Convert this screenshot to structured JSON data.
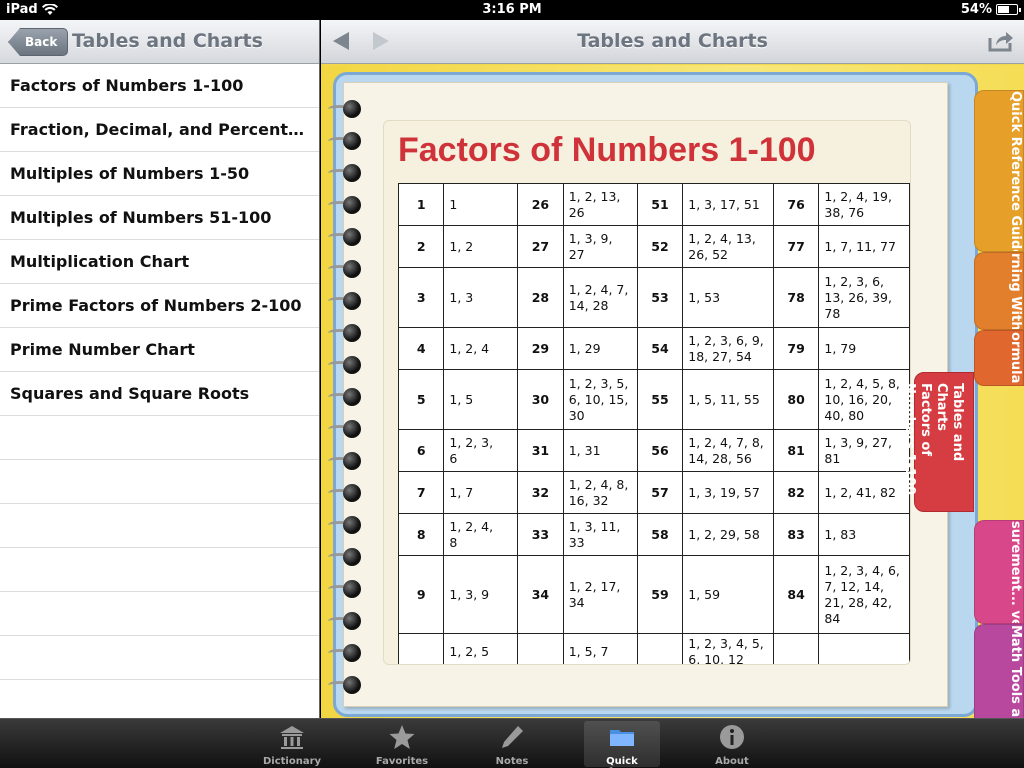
{
  "status": {
    "device": "iPad",
    "time": "3:16 PM",
    "battery": "54%"
  },
  "left": {
    "back_label": "Back",
    "title": "Tables and Charts",
    "items": [
      "Factors of Numbers 1-100",
      "Fraction, Decimal, and Percent Equ...",
      "Multiples of Numbers 1-50",
      "Multiples of Numbers 51-100",
      "Multiplication Chart",
      "Prime Factors of Numbers 2-100",
      "Prime Number Chart",
      "Squares and Square Roots"
    ]
  },
  "right": {
    "title": "Tables and Charts",
    "page_title": "Factors of Numbers 1-100",
    "table_rows": [
      [
        [
          "1",
          "1"
        ],
        [
          "26",
          "1, 2, 13,\n26"
        ],
        [
          "51",
          "1, 3, 17, 51"
        ],
        [
          "76",
          "1, 2, 4, 19,\n38, 76"
        ]
      ],
      [
        [
          "2",
          "1, 2"
        ],
        [
          "27",
          "1, 3, 9,\n27"
        ],
        [
          "52",
          "1, 2, 4, 13,\n26, 52"
        ],
        [
          "77",
          "1, 7, 11, 77"
        ]
      ],
      [
        [
          "3",
          "1, 3"
        ],
        [
          "28",
          "1, 2, 4, 7,\n14, 28"
        ],
        [
          "53",
          "1, 53"
        ],
        [
          "78",
          "1, 2, 3, 6,\n13, 26, 39,\n78"
        ]
      ],
      [
        [
          "4",
          "1, 2, 4"
        ],
        [
          "29",
          "1, 29"
        ],
        [
          "54",
          "1, 2, 3, 6, 9,\n18, 27, 54"
        ],
        [
          "79",
          "1, 79"
        ]
      ],
      [
        [
          "5",
          "1, 5"
        ],
        [
          "30",
          "1, 2, 3, 5,\n6, 10, 15,\n30"
        ],
        [
          "55",
          "1, 5, 11, 55"
        ],
        [
          "80",
          "1, 2, 4, 5, 8,\n10, 16, 20,\n40, 80"
        ]
      ],
      [
        [
          "6",
          "1, 2, 3,\n6"
        ],
        [
          "31",
          "1, 31"
        ],
        [
          "56",
          "1, 2, 4, 7, 8,\n14, 28, 56"
        ],
        [
          "81",
          "1, 3, 9, 27,\n81"
        ]
      ],
      [
        [
          "7",
          "1, 7"
        ],
        [
          "32",
          "1, 2, 4, 8,\n16, 32"
        ],
        [
          "57",
          "1, 3, 19, 57"
        ],
        [
          "82",
          "1, 2, 41, 82"
        ]
      ],
      [
        [
          "8",
          "1, 2, 4,\n8"
        ],
        [
          "33",
          "1, 3, 11,\n33"
        ],
        [
          "58",
          "1, 2, 29, 58"
        ],
        [
          "83",
          "1, 83"
        ]
      ],
      [
        [
          "9",
          "1, 3, 9"
        ],
        [
          "34",
          "1, 2, 17,\n34"
        ],
        [
          "59",
          "1, 59"
        ],
        [
          "84",
          "1, 2, 3, 4, 6,\n7, 12, 14,\n21, 28, 42,\n84"
        ]
      ],
      [
        [
          "",
          "1, 2, 5"
        ],
        [
          "",
          "1, 5, 7"
        ],
        [
          "",
          "1, 2, 3, 4, 5,\n6, 10, 12"
        ],
        [
          "",
          ""
        ]
      ]
    ],
    "tabs": [
      {
        "label": "Quick Reference Guides: Opera...",
        "color": "#e6a02a"
      },
      {
        "label": "rning With ...ipulatives",
        "color": "#e27f2c"
      },
      {
        "label": "ormula",
        "color": "#e0672e"
      },
      {
        "label": "surement... version...",
        "color": "#d8478a"
      },
      {
        "label": "Math Tools and Equipment",
        "color": "#b8489e"
      }
    ],
    "active_tab": {
      "line1": "Tables and Charts",
      "line2": "Factors of Numbers 1-100"
    }
  },
  "tabbar": [
    {
      "label": "Dictionary",
      "icon": "dictionary-icon"
    },
    {
      "label": "Favorites",
      "icon": "star-icon"
    },
    {
      "label": "Notes",
      "icon": "pencil-icon"
    },
    {
      "label": "Quick Reference",
      "icon": "folder-icon",
      "selected": true
    },
    {
      "label": "About",
      "icon": "info-icon"
    }
  ]
}
